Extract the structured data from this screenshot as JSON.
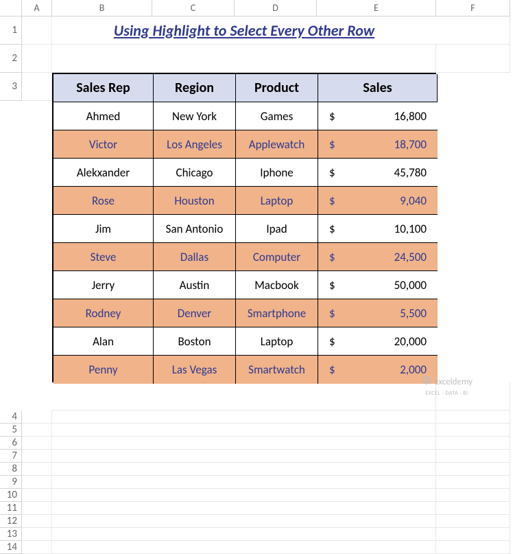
{
  "columns": [
    "A",
    "B",
    "C",
    "D",
    "E",
    "F"
  ],
  "rows": [
    "1",
    "2",
    "3",
    "4",
    "5",
    "6",
    "7",
    "8",
    "9",
    "10",
    "11",
    "12",
    "13",
    "14"
  ],
  "title": "Using Highlight to Select Every Other Row",
  "headers": [
    "Sales Rep",
    "Region",
    "Product",
    "Sales"
  ],
  "data": [
    {
      "rep": "Ahmed",
      "region": "New York",
      "product": "Games",
      "sales": "16,800",
      "hl": false
    },
    {
      "rep": "Victor",
      "region": "Los Angeles",
      "product": "Applewatch",
      "sales": "18,700",
      "hl": true
    },
    {
      "rep": "Alekxander",
      "region": "Chicago",
      "product": "Iphone",
      "sales": "45,780",
      "hl": false
    },
    {
      "rep": "Rose",
      "region": "Houston",
      "product": "Laptop",
      "sales": "9,040",
      "hl": true
    },
    {
      "rep": "Jim",
      "region": "San Antonio",
      "product": "Ipad",
      "sales": "10,100",
      "hl": false
    },
    {
      "rep": "Steve",
      "region": "Dallas",
      "product": "Computer",
      "sales": "24,500",
      "hl": true
    },
    {
      "rep": "Jerry",
      "region": "Austin",
      "product": "Macbook",
      "sales": "50,000",
      "hl": false
    },
    {
      "rep": "Rodney",
      "region": "Denver",
      "product": "Smartphone",
      "sales": "5,500",
      "hl": true
    },
    {
      "rep": "Alan",
      "region": "Boston",
      "product": "Laptop",
      "sales": "20,000",
      "hl": false
    },
    {
      "rep": "Penny",
      "region": "Las Vegas",
      "product": "Smartwatch",
      "sales": "2,000",
      "hl": true
    }
  ],
  "currency": "$",
  "watermark": {
    "brand": "exceldemy",
    "sub": "EXCEL · DATA · BI"
  },
  "chart_data": {
    "type": "table",
    "title": "Using Highlight to Select Every Other Row",
    "columns": [
      "Sales Rep",
      "Region",
      "Product",
      "Sales"
    ],
    "rows": [
      [
        "Ahmed",
        "New York",
        "Games",
        16800
      ],
      [
        "Victor",
        "Los Angeles",
        "Applewatch",
        18700
      ],
      [
        "Alekxander",
        "Chicago",
        "Iphone",
        45780
      ],
      [
        "Rose",
        "Houston",
        "Laptop",
        9040
      ],
      [
        "Jim",
        "San Antonio",
        "Ipad",
        10100
      ],
      [
        "Steve",
        "Dallas",
        "Computer",
        24500
      ],
      [
        "Jerry",
        "Austin",
        "Macbook",
        50000
      ],
      [
        "Rodney",
        "Denver",
        "Smartphone",
        5500
      ],
      [
        "Alan",
        "Boston",
        "Laptop",
        20000
      ],
      [
        "Penny",
        "Las Vegas",
        "Smartwatch",
        2000
      ]
    ]
  }
}
